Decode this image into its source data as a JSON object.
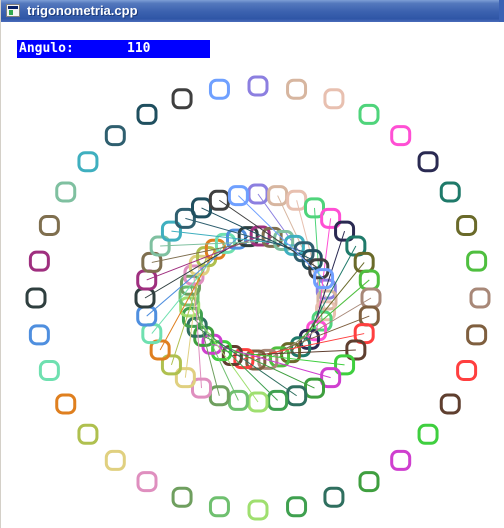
{
  "window": {
    "title": "trigonometria.cpp",
    "icon": "console-app-icon"
  },
  "readout": {
    "label": "Angulo:",
    "value": "110"
  },
  "drawing": {
    "rings": [
      "outer",
      "inner",
      "center"
    ],
    "spoke_count": 36,
    "palette": [
      "#8c7fe0",
      "#d7b6a0",
      "#e8c0b0",
      "#4fd47b",
      "#ff4fd4",
      "#2a2a52",
      "#1f7a6a",
      "#6a6a2a",
      "#4fbf3f",
      "#a88878",
      "#7f5f3f",
      "#ff3f3f",
      "#5f3f2f",
      "#3fcf3f",
      "#cf3fcf",
      "#3f9f3f",
      "#2f6f5f",
      "#3fa04f",
      "#9fdf6f",
      "#6fc06f",
      "#6f9f5f",
      "#df8fbf",
      "#e0d080",
      "#afc04f",
      "#df7f1f",
      "#6fe0b0",
      "#4f8fdf",
      "#2f3f3f",
      "#9f2f7f",
      "#7f6f4f",
      "#7fc0a0",
      "#3fafbf",
      "#2f5f6f",
      "#1f4f5f",
      "#3f3f3f",
      "#6fa0ff"
    ]
  }
}
